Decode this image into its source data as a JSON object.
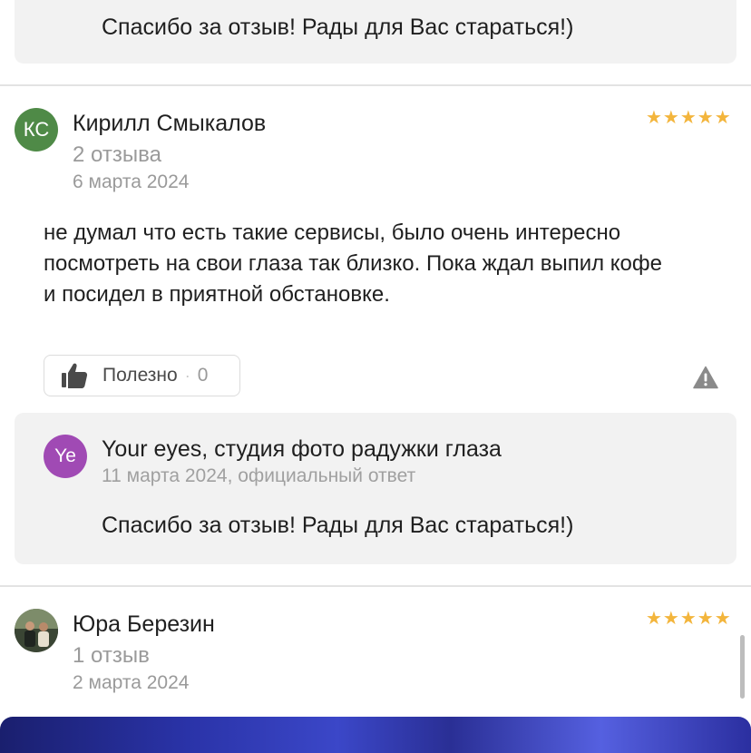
{
  "top_reply": {
    "text": "Спасибо за отзыв! Рады для Вас стараться!)"
  },
  "reviews": [
    {
      "avatar_initials": "КС",
      "avatar_color": "#4f8a47",
      "author": "Кирилл Смыкалов",
      "reviews_count": "2 отзыва",
      "date": "6 марта 2024",
      "rating": 5,
      "stars": "★★★★★",
      "text": "не думал что есть такие сервисы, было очень интересно посмотреть на свои глаза так близко. Пока ждал выпил кофе и посидел в приятной обстановке.",
      "useful_label": "Полезно",
      "useful_separator": "·",
      "useful_count": "0",
      "reply": {
        "avatar_initials": "Ye",
        "org_name": "Your eyes, студия фото радужки глаза",
        "meta": "11 марта 2024, официальный ответ",
        "text": "Спасибо за отзыв! Рады для Вас стараться!)"
      }
    },
    {
      "author": "Юра Березин",
      "reviews_count": "1 отзыв",
      "date": "2 марта 2024",
      "rating": 5,
      "stars": "★★★★★"
    }
  ],
  "colors": {
    "star": "#f3b53c",
    "reply_bg": "#f2f2f2",
    "org_avatar": "#a04ab4"
  },
  "icons": {
    "useful": "thumbs-up-icon",
    "report": "warning-icon"
  }
}
